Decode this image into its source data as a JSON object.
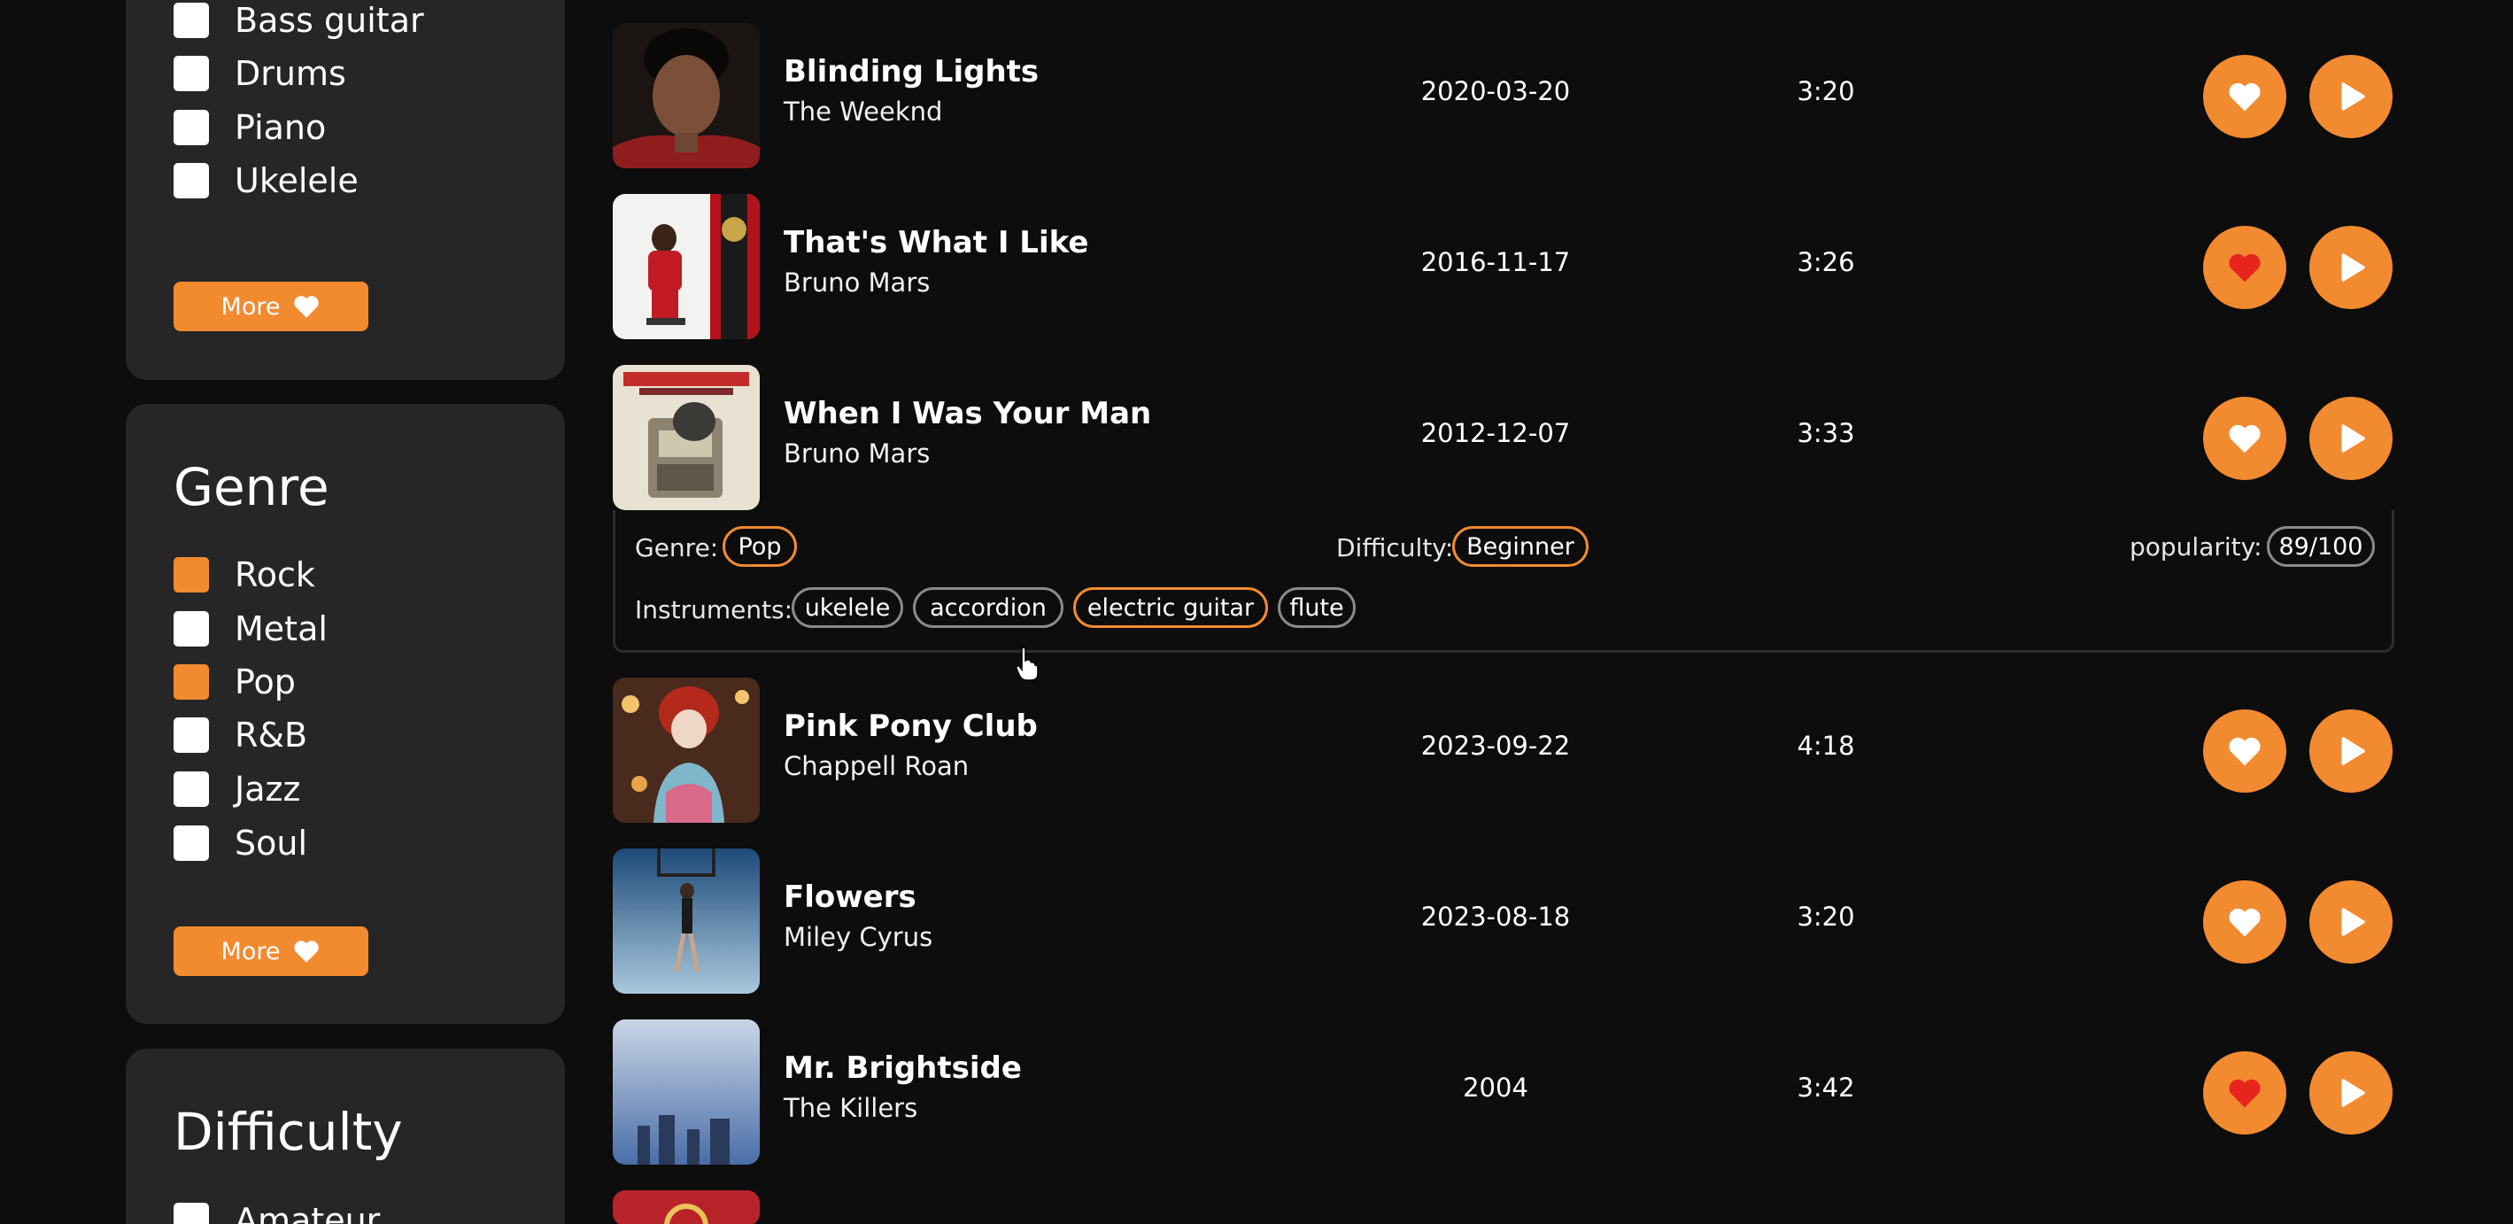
{
  "instrument_filter": {
    "items": [
      {
        "label": "Bass guitar",
        "checked": false
      },
      {
        "label": "Drums",
        "checked": false
      },
      {
        "label": "Piano",
        "checked": false
      },
      {
        "label": "Ukelele",
        "checked": false
      }
    ],
    "more_label": "More"
  },
  "genre_filter": {
    "title": "Genre",
    "items": [
      {
        "label": "Rock",
        "checked": true
      },
      {
        "label": "Metal",
        "checked": false
      },
      {
        "label": "Pop",
        "checked": true
      },
      {
        "label": "R&B",
        "checked": false
      },
      {
        "label": "Jazz",
        "checked": false
      },
      {
        "label": "Soul",
        "checked": false
      }
    ],
    "more_label": "More"
  },
  "difficulty_filter": {
    "title": "Difficulty",
    "items": [
      {
        "label": "Amateur",
        "checked": false
      }
    ]
  },
  "songs": [
    {
      "title": "Blinding Lights",
      "artist": "The Weeknd",
      "date": "2020-03-20",
      "duration": "3:20",
      "liked": false
    },
    {
      "title": "That's What I Like",
      "artist": "Bruno Mars",
      "date": "2016-11-17",
      "duration": "3:26",
      "liked": true
    },
    {
      "title": "When I Was Your Man",
      "artist": "Bruno Mars",
      "date": "2012-12-07",
      "duration": "3:33",
      "liked": false
    },
    {
      "title": "Pink Pony Club",
      "artist": "Chappell Roan",
      "date": "2023-09-22",
      "duration": "4:18",
      "liked": false
    },
    {
      "title": "Flowers",
      "artist": "Miley Cyrus",
      "date": "2023-08-18",
      "duration": "3:20",
      "liked": false
    },
    {
      "title": "Mr. Brightside",
      "artist": "The Killers",
      "date": "2004",
      "duration": "3:42",
      "liked": true
    }
  ],
  "expanded_song": {
    "genre_label": "Genre:",
    "genre": "Pop",
    "difficulty_label": "Difficulty:",
    "difficulty": "Beginner",
    "popularity_label": "popularity:",
    "popularity": "89/100",
    "instruments_label": "Instruments:",
    "instruments": [
      {
        "name": "ukelele",
        "highlighted": false
      },
      {
        "name": "accordion",
        "highlighted": false
      },
      {
        "name": "electric guitar",
        "highlighted": true
      },
      {
        "name": "flute",
        "highlighted": false
      }
    ]
  },
  "icons": {
    "like": "heart-icon",
    "play": "play-icon",
    "more": "heart-icon"
  },
  "colors": {
    "accent": "#f28a30",
    "liked": "#e8251d",
    "panel": "#262626",
    "background": "#0d0d0d"
  }
}
